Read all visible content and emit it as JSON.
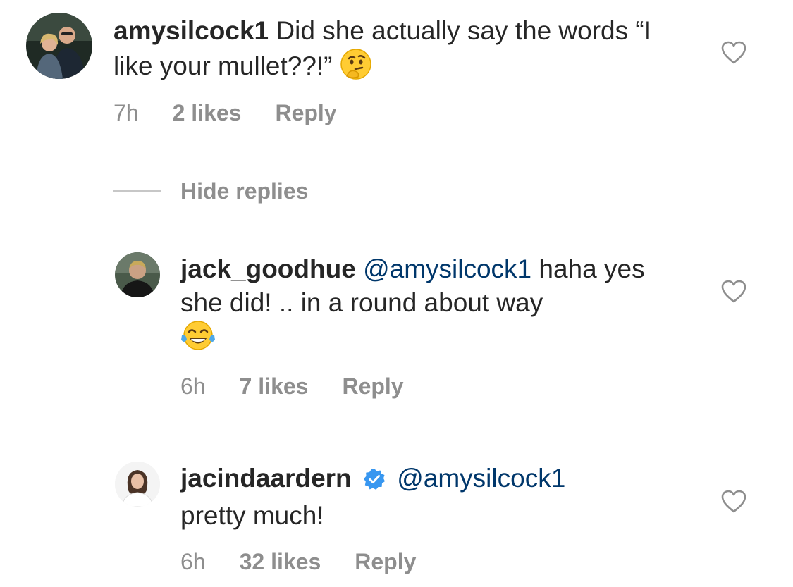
{
  "comments": [
    {
      "username": "amysilcock1",
      "text": "Did she actually say the words “I like your mullet??!”",
      "emoji": "thinking-face",
      "time": "7h",
      "likes": "2 likes",
      "reply": "Reply",
      "avatar": "couple-photo"
    },
    {
      "username": "jack_goodhue",
      "mention": "@amysilcock1",
      "text": "haha yes she did! .. in a round about way",
      "emoji": "tears-of-joy",
      "time": "6h",
      "likes": "7 likes",
      "reply": "Reply",
      "avatar": "man-photo"
    },
    {
      "username": "jacindaardern",
      "verified": true,
      "mention": "@amysilcock1",
      "text": "pretty much!",
      "time": "6h",
      "likes": "32 likes",
      "reply": "Reply",
      "avatar": "woman-photo"
    }
  ],
  "hide_replies": "Hide replies",
  "colors": {
    "text": "#262626",
    "meta": "#8e8e8e",
    "mention": "#00376b",
    "verified": "#3897f0"
  }
}
